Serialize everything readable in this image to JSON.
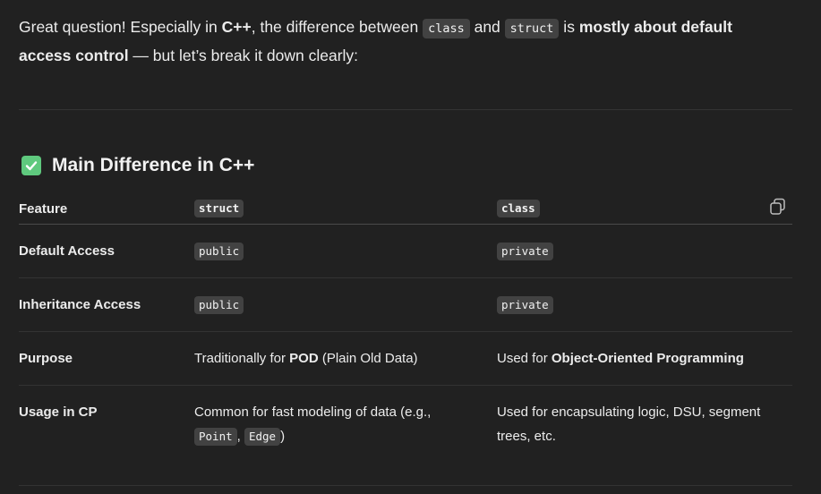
{
  "intro": {
    "p1": "Great question! Especially in ",
    "b1": "C++",
    "p2": ", the difference between ",
    "code1": "class",
    "p3": " and ",
    "code2": "struct",
    "p4": " is ",
    "b2": "mostly about default access control",
    "p5": " — but let’s break it down clearly:"
  },
  "heading": {
    "icon": "check-mark-icon",
    "text": "Main Difference in C++"
  },
  "table": {
    "headers": [
      "Feature",
      "struct",
      "class"
    ],
    "rows": [
      {
        "feature": "Default Access",
        "struct": "public",
        "class": "private"
      },
      {
        "feature": "Inheritance Access",
        "struct": "public",
        "class": "private"
      },
      {
        "feature": "Purpose",
        "struct_prefix": "Traditionally for ",
        "struct_bold": "POD",
        "struct_suffix": " (Plain Old Data)",
        "class_prefix": "Used for ",
        "class_bold": "Object-Oriented Programming"
      },
      {
        "feature": "Usage in CP",
        "struct_text": "Common for fast modeling of data (e.g.,",
        "struct_code1": "Point",
        "struct_sep": ",",
        "struct_code2": "Edge",
        "struct_end": ")",
        "class_text": "Used for encapsulating logic, DSU, segment trees, etc."
      }
    ]
  },
  "icons": {
    "copy": "copy-icon"
  },
  "colors": {
    "background": "#212121",
    "check": "#5fc97e",
    "code_bg": "#424242"
  }
}
